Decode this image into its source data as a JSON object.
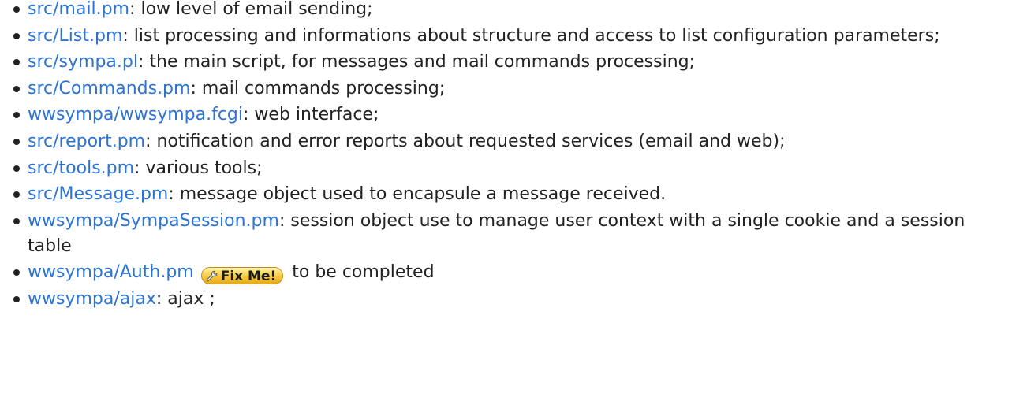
{
  "items": [
    {
      "link": "src/mail.pm",
      "text": ": low level of email sending;"
    },
    {
      "link": "src/List.pm",
      "text": ": list processing and informations about structure and access to list configuration parameters;"
    },
    {
      "link": "src/sympa.pl",
      "text": ": the main script, for messages and mail commands processing;"
    },
    {
      "link": "src/Commands.pm",
      "text": ": mail commands processing;"
    },
    {
      "link": "wwsympa/wwsympa.fcgi",
      "text": ": web interface;"
    },
    {
      "link": "src/report.pm",
      "text": ": notification and error reports about requested services (email and web);"
    },
    {
      "link": "src/tools.pm",
      "text": ": various tools;"
    },
    {
      "link": "src/Message.pm",
      "text": ": message object used to encapsule a message received."
    },
    {
      "link": "wwsympa/SympaSession.pm",
      "text": ": session object use to manage user context with a single cookie and a session table"
    },
    {
      "link": "wwsympa/Auth.pm",
      "badge": "Fix Me!",
      "text": "to be completed"
    },
    {
      "link": "wwsympa/ajax",
      "text": ": ajax ;"
    }
  ],
  "colors": {
    "link": "#2b73d4",
    "text": "#222222",
    "badge_fill": "#f5c840"
  },
  "icons": {
    "badge_icon": "wrench-icon",
    "bullet": "bullet-dot"
  }
}
